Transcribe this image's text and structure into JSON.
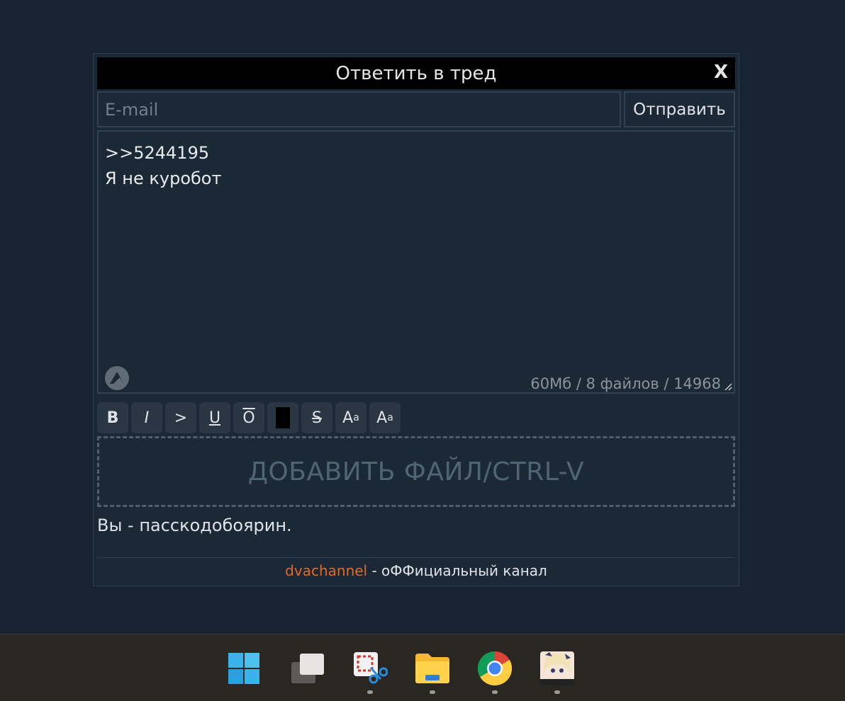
{
  "dialog": {
    "title": "Ответить в тред",
    "close_label": "X"
  },
  "email": {
    "placeholder": "E-mail",
    "value": ""
  },
  "send_label": "Отправить",
  "comment": {
    "text": ">>5244195\nЯ не куробот",
    "counter": "60Мб / 8 файлов / 14968"
  },
  "toolbar": {
    "bold": "B",
    "italic": "I",
    "quote": ">",
    "underline": "U",
    "overline": "O",
    "strike": "S",
    "sup_main": "A",
    "sup_small": "a",
    "sub_main": "A",
    "sub_small": "a"
  },
  "dropzone_label": "ДОБАВИТЬ ФАЙЛ/CTRL-V",
  "status": "Вы - пасскодобоярин.",
  "footer": {
    "link": "dvachannel",
    "text": " - оФФициальный канал"
  },
  "taskbar": {
    "items": [
      {
        "icon": "windows-start-icon",
        "active": false
      },
      {
        "icon": "task-view-icon",
        "active": false
      },
      {
        "icon": "snipping-tool-icon",
        "active": true
      },
      {
        "icon": "file-explorer-icon",
        "active": true
      },
      {
        "icon": "chrome-icon",
        "active": true
      },
      {
        "icon": "hoyoverse-app-icon",
        "active": true
      }
    ]
  }
}
